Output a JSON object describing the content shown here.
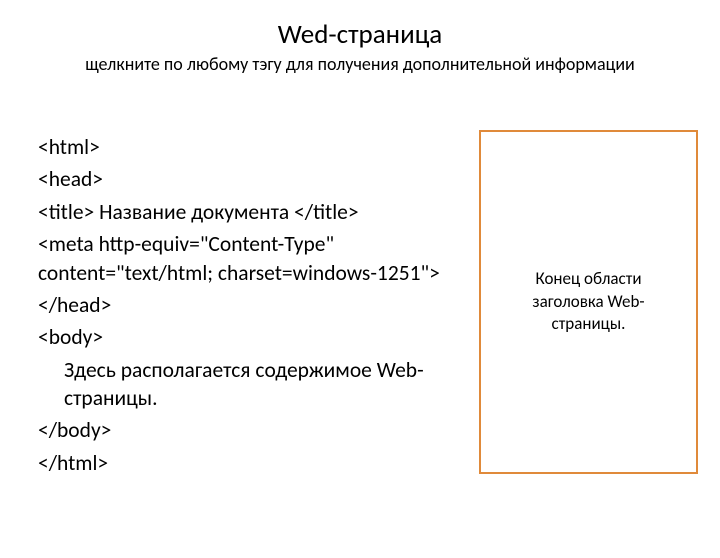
{
  "header": {
    "title": "Wed-страница",
    "subtitle": "щелкните по любому тэгу для получения дополнительной информации"
  },
  "code": {
    "l1": "<html>",
    "l2": "<head>",
    "l3": "<title> Название документа </title>",
    "l4": "<meta http-equiv=\"Content-Type\" content=\"text/html; charset=windows-1251\">",
    "l5": "</head>",
    "l6": "<body>",
    "l7": "Здесь располагается содержимое Web-страницы.",
    "l8": "</body>",
    "l9": "</html>"
  },
  "sidebox": {
    "text": "Конец области заголовка Web-страницы."
  }
}
